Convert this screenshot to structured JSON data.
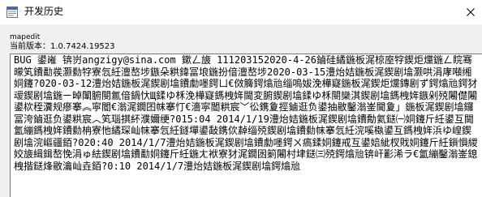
{
  "window": {
    "title": "开发历史"
  },
  "info": {
    "name": "mapedit",
    "version_line": "当前版本：1.0.7424.19523"
  },
  "history": {
    "text": "BUG 鍙嶉    锛岃angzigy@sina.com 鏉ㄥ旇 111203152020-4-26鏀硅繘鍦板浘椋庢牸鍥炬爣鍦ㄥ睆骞曚笂鐨勫彂灏勬牸寮忥紝澶嶅埗鏃朵粠鍏冨埌鍦扮偣澶嶅埗2020-03-15澧炲姞鍦板浘鍥剧墖灏哄涓庨噸缃姛鑳?020-03-12澧炲姞鍦板浘鍥剧墖鐨勮嚜鍔ㄩ€傚簲鍔熻兘缁嗚妭浼樺寲鍦板浘鍥炬爣鏄剧ず鍔熻兘鍔犲叆鍥剧墖鍦ㄧ晫闈腑閿氱偣鍋忕Щ鍒ゆ柇浼樺寲鎷栧姩閫変腑鍥剧墖鍒ゆ柇閿欒淇鍥剧墖鎷栧姩鏃剁殑闂儊闂鍙栨秷瀵规瘮搴︽寜閽€滃浘鐗囨帓搴忊€濇寜閽粠宸﹀彸鎸夐挳鏀逛负鍙抽敭鑿滃崟閫夐」鍦板浘鍥剧墖鑼冨洿鏀逛负鍙粠宸︿笂瑙掑紑濮嬭绠?015:04 2014/1/19澧炲姞鍦板浘鍥剧墖鐨勪氦鎹㈠姛鑳斤紝鍙互閫氳繃鎷栧姩鐨勬柟寮忚繘琛屾帓搴忥紝鐩墠鍙敮鎸佽繛缁殑鍥剧墖鐨勬帓搴忥紝浣嗘槸鍙互鎷栧姩浜ゆ崲鍥剧墖浣嶇疆銆?020:40 2014/1/7澧炲姞鍦板浘鍥剧墖鐨勮嚜鍔ㄨ瘑鍒姛鑳戒互鍙婄紪杈戝姛鑳斤紝鎻愪緵姣旇緝鍓嶅悗涓ゅ紶鍥剧墖鐨勫姛鑳斤紝鍦ㄤ袱寮犲浘鐗囦箣闂村垏鎹㈢殑鍔熻兘锛屽彲浠ラ€氳繃鑿滃崟鎴栧揩鎹烽敭瀹屾垚銆?0:10 2014/1/7澧炲姞鍦板浘鍥剧墖鍔熻兘"
  },
  "icons": {
    "app": "app-icon",
    "close": "close-icon"
  },
  "colors": {
    "titlebar": "#ffffff",
    "window": "#f0f0f0",
    "textbox": "#ffffff"
  }
}
